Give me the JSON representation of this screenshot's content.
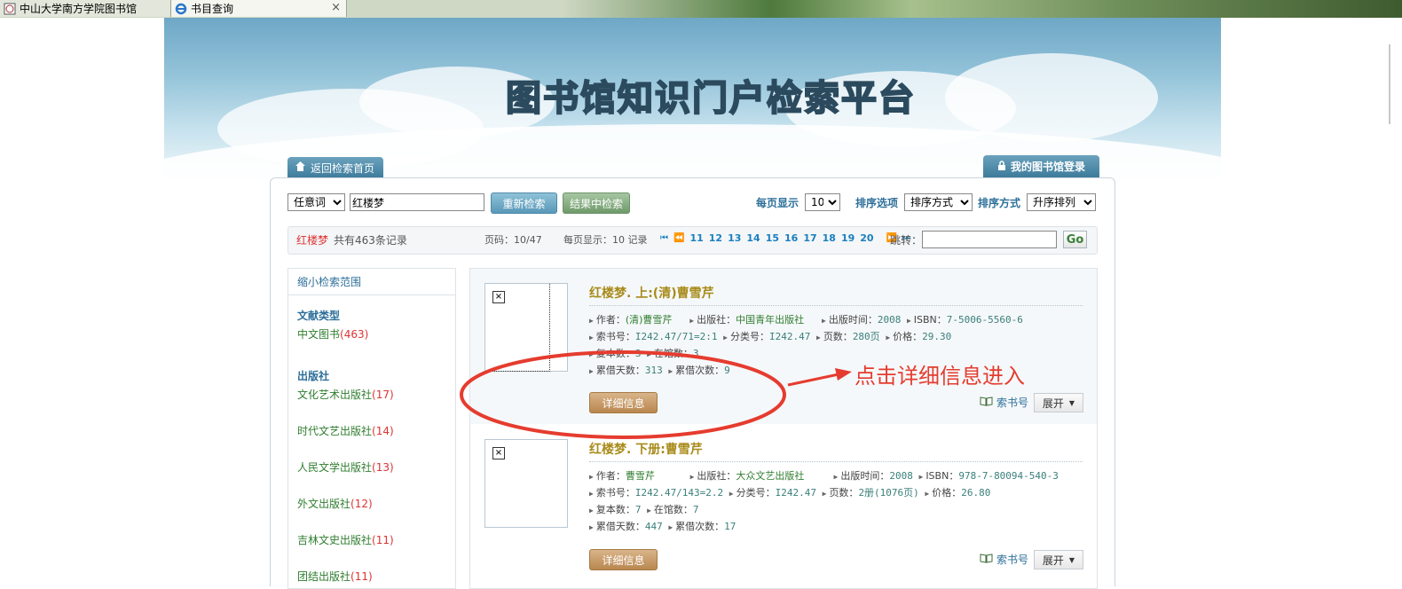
{
  "browser": {
    "tabs": [
      {
        "label": "中山大学南方学院图书馆"
      },
      {
        "label": "书目查询",
        "close": "×"
      }
    ]
  },
  "header": {
    "site_title": "图书馆知识门户检索平台",
    "back_tab": "返回检索首页",
    "login_tab": "我的图书馆登录"
  },
  "search": {
    "field_select": "任意词",
    "query": "红楼梦",
    "research_button": "重新检索",
    "within_button": "结果中检索",
    "per_page_label": "每页显示",
    "per_page_value": "10",
    "sort_label": "排序选项",
    "sort_value": "排序方式",
    "order_label": "排序方式",
    "order_value": "升序排列"
  },
  "summary": {
    "keyword": "红楼梦",
    "total": "共有463条记录",
    "page_info": "页码：10/47",
    "per_page_info": "每页显示：10 记录",
    "pages": [
      "11",
      "12",
      "13",
      "14",
      "15",
      "16",
      "17",
      "18",
      "19",
      "20"
    ],
    "jump_label": "跳转：",
    "go_button": "Go"
  },
  "sidebar": {
    "title": "缩小检索范围",
    "sections": [
      {
        "heading": "文献类型",
        "items": [
          {
            "label": "中文图书",
            "count": "(463)"
          }
        ]
      },
      {
        "heading": "出版社",
        "items": [
          {
            "label": "文化艺术出版社",
            "count": "(17)"
          },
          {
            "label": "时代文艺出版社",
            "count": "(14)"
          },
          {
            "label": "人民文学出版社",
            "count": "(13)"
          },
          {
            "label": "外文出版社",
            "count": "(12)"
          },
          {
            "label": "吉林文史出版社",
            "count": "(11)"
          },
          {
            "label": "团结出版社",
            "count": "(11)"
          }
        ]
      }
    ]
  },
  "results": [
    {
      "title": "红楼梦. 上:(清)曹雪芹",
      "author_label": "作者：",
      "author": "(清)曹雪芹",
      "publisher_label": "出版社：",
      "publisher": "中国青年出版社",
      "date_label": "出版时间：",
      "date": "2008",
      "isbn_label": "ISBN：",
      "isbn": "7-5006-5560-6",
      "call_label": "索书号：",
      "call": "I242.47/71=2:1",
      "class_label": "分类号：",
      "class": "I242.47",
      "pages_label": "页数：",
      "pages": "280页",
      "price_label": "价格：",
      "price": "29.30",
      "copies_label": "复本数：",
      "copies": "3",
      "avail_label": "在馆数：",
      "avail": "3",
      "days_label": "累借天数：",
      "days": "313",
      "times_label": "累借次数：",
      "times": "9",
      "detail_button": "详细信息",
      "callno_link": "索书号",
      "expand_button": "展开"
    },
    {
      "title": "红楼梦. 下册:曹雪芹",
      "author_label": "作者：",
      "author": "曹雪芹",
      "publisher_label": "出版社：",
      "publisher": "大众文艺出版社",
      "date_label": "出版时间：",
      "date": "2008",
      "isbn_label": "ISBN：",
      "isbn": "978-7-80094-540-3",
      "call_label": "索书号：",
      "call": "I242.47/143=2.2",
      "class_label": "分类号：",
      "class": "I242.47",
      "pages_label": "页数：",
      "pages": "2册(1076页)",
      "price_label": "价格：",
      "price": "26.80",
      "copies_label": "复本数：",
      "copies": "7",
      "avail_label": "在馆数：",
      "avail": "7",
      "days_label": "累借天数：",
      "days": "447",
      "times_label": "累借次数：",
      "times": "17",
      "detail_button": "详细信息",
      "callno_link": "索书号",
      "expand_button": "展开"
    }
  ],
  "annotation": {
    "text": "点击详细信息进入",
    "color": "#e53c2f"
  }
}
